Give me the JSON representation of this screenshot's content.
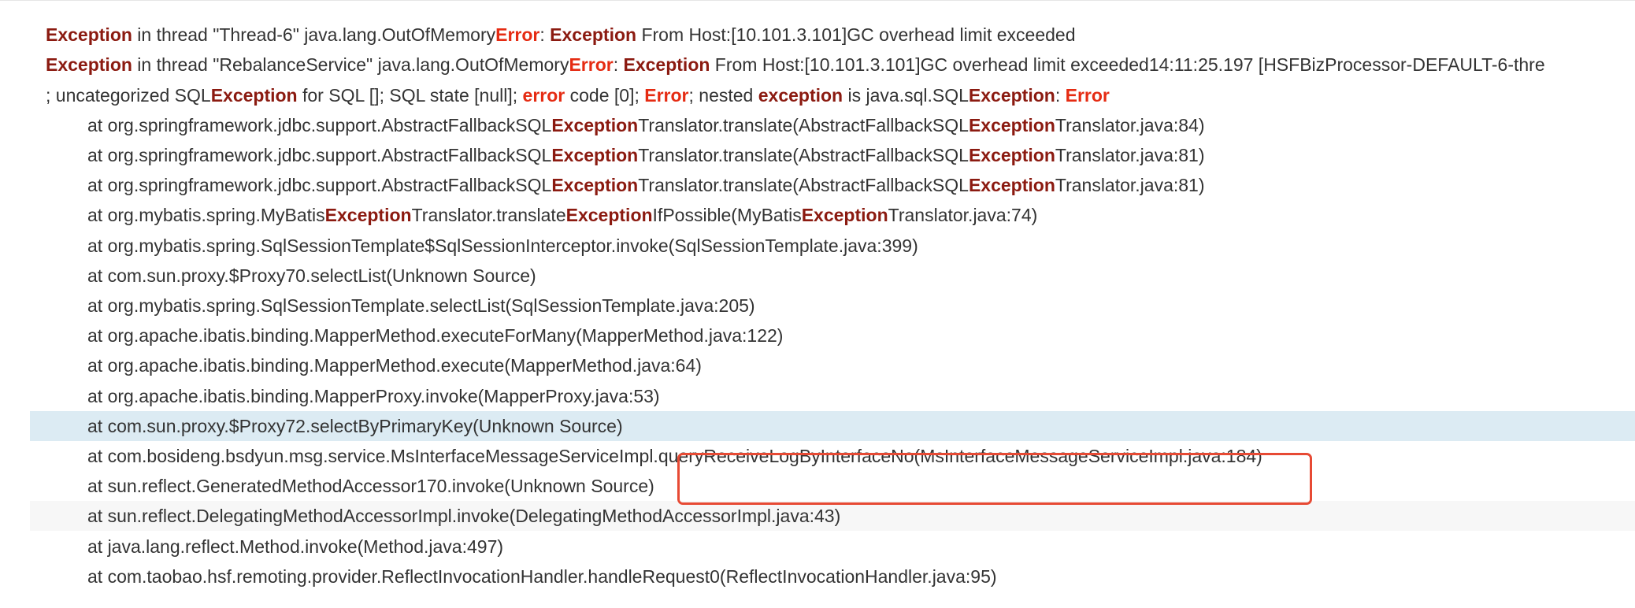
{
  "log": {
    "lines": [
      {
        "indent": false,
        "style": "",
        "segments": [
          {
            "t": "",
            "c": ""
          }
        ]
      },
      {
        "indent": false,
        "style": "",
        "segments": [
          {
            "t": "Exception",
            "c": "kw"
          },
          {
            "t": " in thread \"Thread-6\" java.lang.OutOfMemory",
            "c": ""
          },
          {
            "t": "Error",
            "c": "err"
          },
          {
            "t": ": ",
            "c": ""
          },
          {
            "t": "Exception",
            "c": "kw"
          },
          {
            "t": " From Host:[10.101.3.101]GC overhead limit exceeded",
            "c": ""
          }
        ]
      },
      {
        "indent": false,
        "style": "",
        "segments": [
          {
            "t": "Exception",
            "c": "kw"
          },
          {
            "t": " in thread \"RebalanceService\" java.lang.OutOfMemory",
            "c": ""
          },
          {
            "t": "Error",
            "c": "err"
          },
          {
            "t": ": ",
            "c": ""
          },
          {
            "t": "Exception",
            "c": "kw"
          },
          {
            "t": " From Host:[10.101.3.101]GC overhead limit exceeded14:11:25.197 [HSFBizProcessor-DEFAULT-6-thre",
            "c": ""
          }
        ]
      },
      {
        "indent": false,
        "style": "",
        "segments": [
          {
            "t": "; uncategorized SQL",
            "c": ""
          },
          {
            "t": "Exception",
            "c": "kw"
          },
          {
            "t": " for SQL []; SQL state [null]; ",
            "c": ""
          },
          {
            "t": "error",
            "c": "err"
          },
          {
            "t": " code [0]; ",
            "c": ""
          },
          {
            "t": "Error",
            "c": "err"
          },
          {
            "t": "; nested ",
            "c": ""
          },
          {
            "t": "exception",
            "c": "kw"
          },
          {
            "t": " is java.sql.SQL",
            "c": ""
          },
          {
            "t": "Exception",
            "c": "kw"
          },
          {
            "t": ": ",
            "c": ""
          },
          {
            "t": "Error",
            "c": "err"
          }
        ]
      },
      {
        "indent": true,
        "style": "",
        "segments": [
          {
            "t": "at org.springframework.jdbc.support.AbstractFallbackSQL",
            "c": ""
          },
          {
            "t": "Exception",
            "c": "kw"
          },
          {
            "t": "Translator.translate(AbstractFallbackSQL",
            "c": ""
          },
          {
            "t": "Exception",
            "c": "kw"
          },
          {
            "t": "Translator.java:84)",
            "c": ""
          }
        ]
      },
      {
        "indent": true,
        "style": "",
        "segments": [
          {
            "t": "at org.springframework.jdbc.support.AbstractFallbackSQL",
            "c": ""
          },
          {
            "t": "Exception",
            "c": "kw"
          },
          {
            "t": "Translator.translate(AbstractFallbackSQL",
            "c": ""
          },
          {
            "t": "Exception",
            "c": "kw"
          },
          {
            "t": "Translator.java:81)",
            "c": ""
          }
        ]
      },
      {
        "indent": true,
        "style": "",
        "segments": [
          {
            "t": "at org.springframework.jdbc.support.AbstractFallbackSQL",
            "c": ""
          },
          {
            "t": "Exception",
            "c": "kw"
          },
          {
            "t": "Translator.translate(AbstractFallbackSQL",
            "c": ""
          },
          {
            "t": "Exception",
            "c": "kw"
          },
          {
            "t": "Translator.java:81)",
            "c": ""
          }
        ]
      },
      {
        "indent": true,
        "style": "",
        "segments": [
          {
            "t": "at org.mybatis.spring.MyBatis",
            "c": ""
          },
          {
            "t": "Exception",
            "c": "kw"
          },
          {
            "t": "Translator.translate",
            "c": ""
          },
          {
            "t": "Exception",
            "c": "kw"
          },
          {
            "t": "IfPossible(MyBatis",
            "c": ""
          },
          {
            "t": "Exception",
            "c": "kw"
          },
          {
            "t": "Translator.java:74)",
            "c": ""
          }
        ]
      },
      {
        "indent": true,
        "style": "",
        "segments": [
          {
            "t": "at org.mybatis.spring.SqlSessionTemplate$SqlSessionInterceptor.invoke(SqlSessionTemplate.java:399)",
            "c": ""
          }
        ]
      },
      {
        "indent": true,
        "style": "",
        "segments": [
          {
            "t": "at com.sun.proxy.$Proxy70.selectList(Unknown Source)",
            "c": ""
          }
        ]
      },
      {
        "indent": true,
        "style": "",
        "segments": [
          {
            "t": "at org.mybatis.spring.SqlSessionTemplate.selectList(SqlSessionTemplate.java:205)",
            "c": ""
          }
        ]
      },
      {
        "indent": true,
        "style": "",
        "segments": [
          {
            "t": "at org.apache.ibatis.binding.MapperMethod.executeForMany(MapperMethod.java:122)",
            "c": ""
          }
        ]
      },
      {
        "indent": true,
        "style": "",
        "segments": [
          {
            "t": "at org.apache.ibatis.binding.MapperMethod.execute(MapperMethod.java:64)",
            "c": ""
          }
        ]
      },
      {
        "indent": true,
        "style": "",
        "segments": [
          {
            "t": "at org.apache.ibatis.binding.MapperProxy.invoke(MapperProxy.java:53)",
            "c": ""
          }
        ]
      },
      {
        "indent": true,
        "style": "hover",
        "segments": [
          {
            "t": "at com.sun.proxy.$Proxy72.selectByPrimaryKey(Unknown Source)",
            "c": ""
          }
        ]
      },
      {
        "indent": true,
        "style": "",
        "segments": [
          {
            "t": "at com.bosideng.bsdyun.msg.service.MsInterfaceMessageServiceImpl.queryReceiveLogByInterfaceNo(MsInterfaceMessageServiceImpl.java:184)",
            "c": ""
          }
        ]
      },
      {
        "indent": true,
        "style": "",
        "segments": [
          {
            "t": "at sun.reflect.GeneratedMethodAccessor170.invoke(Unknown Source)",
            "c": ""
          }
        ]
      },
      {
        "indent": true,
        "style": "stripe",
        "segments": [
          {
            "t": "at sun.reflect.DelegatingMethodAccessorImpl.invoke(DelegatingMethodAccessorImpl.java:43)",
            "c": ""
          }
        ]
      },
      {
        "indent": true,
        "style": "",
        "segments": [
          {
            "t": "at java.lang.reflect.Method.invoke(Method.java:497)",
            "c": ""
          }
        ]
      },
      {
        "indent": true,
        "style": "",
        "segments": [
          {
            "t": "at com.taobao.hsf.remoting.provider.ReflectInvocationHandler.handleRequest0(ReflectInvocationHandler.java:95)",
            "c": ""
          }
        ]
      }
    ]
  },
  "colors": {
    "keyword": "#8b1a10",
    "error": "#e52b12",
    "text": "#333333",
    "hover_row": "#dcebf3",
    "stripe_row": "#f7f7f7",
    "annotation_box": "#e74a34"
  }
}
